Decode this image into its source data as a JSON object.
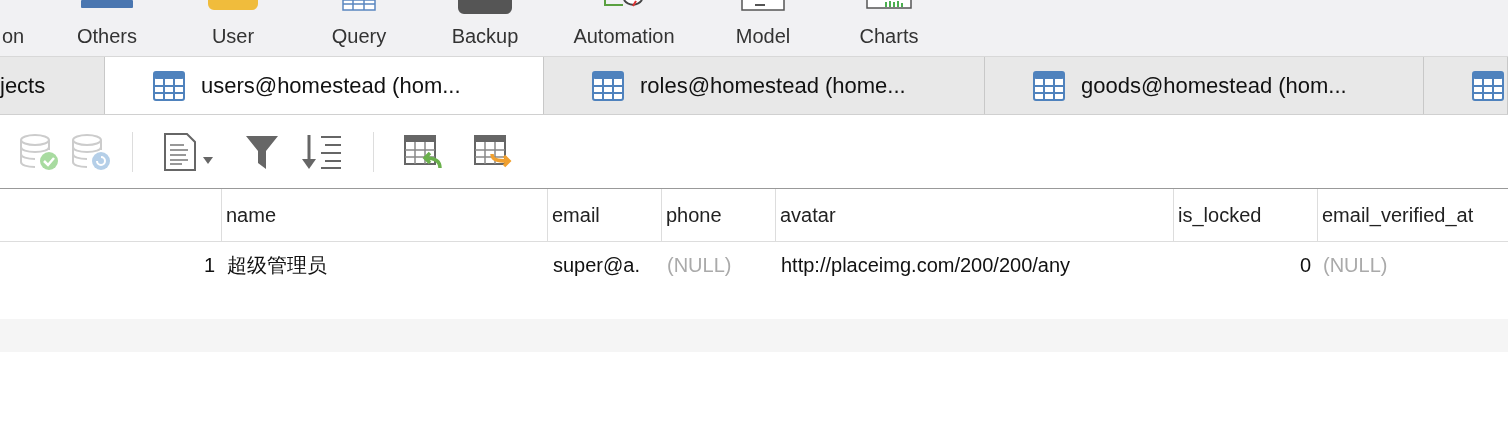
{
  "toolbar": {
    "items": [
      {
        "label": "on"
      },
      {
        "label": "Others"
      },
      {
        "label": "User"
      },
      {
        "label": "Query"
      },
      {
        "label": "Backup"
      },
      {
        "label": "Automation"
      },
      {
        "label": "Model"
      },
      {
        "label": "Charts"
      }
    ]
  },
  "tabs": [
    {
      "label": "jects",
      "selected": false
    },
    {
      "label": "users@homestead (hom...",
      "selected": true
    },
    {
      "label": "roles@homestead (home...",
      "selected": false
    },
    {
      "label": "goods@homestead (hom...",
      "selected": false
    },
    {
      "selected": false
    }
  ],
  "table": {
    "columns": [
      "",
      "name",
      "email",
      "phone",
      "avatar",
      "is_locked",
      "email_verified_at"
    ],
    "rows": [
      {
        "cells": [
          {
            "text": "1",
            "kind": "number"
          },
          {
            "text": "超级管理员",
            "kind": "text"
          },
          {
            "text": "super@a.",
            "kind": "text"
          },
          {
            "text": "(NULL)",
            "kind": "null"
          },
          {
            "text": "http://placeimg.com/200/200/any",
            "kind": "text"
          },
          {
            "text": "0",
            "kind": "number"
          },
          {
            "text": "(NULL)",
            "kind": "null"
          }
        ]
      }
    ]
  }
}
